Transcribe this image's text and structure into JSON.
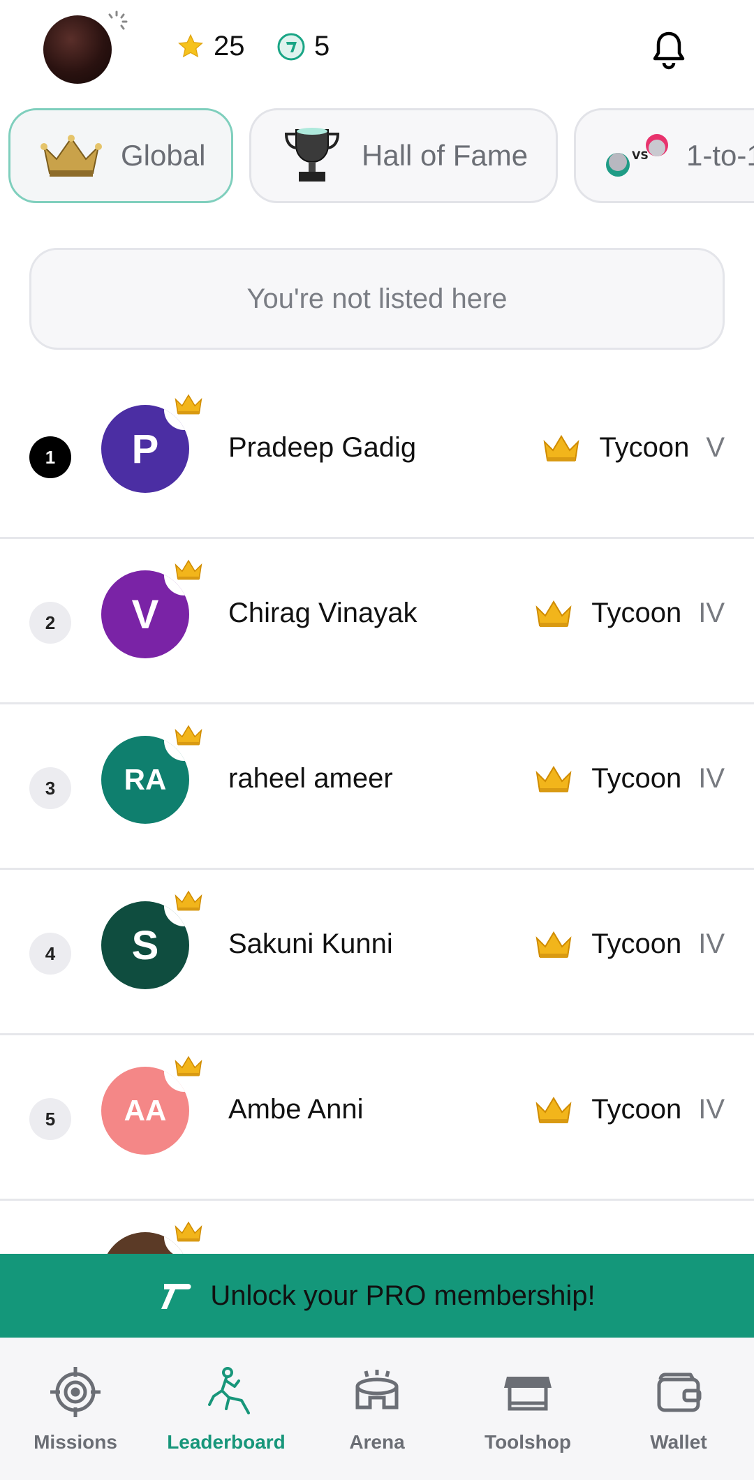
{
  "header": {
    "stars_count": "25",
    "coins_count": "5",
    "icons": {
      "profile": "avatar",
      "star": "star-icon",
      "coin": "coin-icon",
      "bell": "bell-icon"
    }
  },
  "tabs": [
    {
      "label": "Global",
      "icon": "crown-icon",
      "active": true
    },
    {
      "label": "Hall of Fame",
      "icon": "trophy-icon",
      "active": false
    },
    {
      "label": "1-to-1",
      "icon": "vs-icon",
      "active": false
    }
  ],
  "not_listed_text": "You're not listed here",
  "leaderboard": [
    {
      "rank": "1",
      "initials": "P",
      "name": "Pradeep Gadig",
      "tier": "Tycoon",
      "level": "V",
      "avatar_color": "#4b2ea3"
    },
    {
      "rank": "2",
      "initials": "V",
      "name": "Chirag Vinayak",
      "tier": "Tycoon",
      "level": "IV",
      "avatar_color": "#7a23a6"
    },
    {
      "rank": "3",
      "initials": "RA",
      "name": "raheel ameer",
      "tier": "Tycoon",
      "level": "IV",
      "avatar_color": "#0f7f6e"
    },
    {
      "rank": "4",
      "initials": "S",
      "name": "Sakuni Kunni",
      "tier": "Tycoon",
      "level": "IV",
      "avatar_color": "#0f4d3f"
    },
    {
      "rank": "5",
      "initials": "AA",
      "name": "Ambe Anni",
      "tier": "Tycoon",
      "level": "IV",
      "avatar_color": "#f48787"
    }
  ],
  "pro_banner": {
    "text": "Unlock your PRO membership!"
  },
  "bottom_nav": [
    {
      "label": "Missions",
      "icon": "target-icon",
      "active": false
    },
    {
      "label": "Leaderboard",
      "icon": "climber-icon",
      "active": true
    },
    {
      "label": "Arena",
      "icon": "arena-icon",
      "active": false
    },
    {
      "label": "Toolshop",
      "icon": "shop-icon",
      "active": false
    },
    {
      "label": "Wallet",
      "icon": "wallet-icon",
      "active": false
    }
  ],
  "colors": {
    "accent": "#14977a",
    "active_tab_border": "#7fcfbd",
    "gold": "#f2b51b"
  }
}
